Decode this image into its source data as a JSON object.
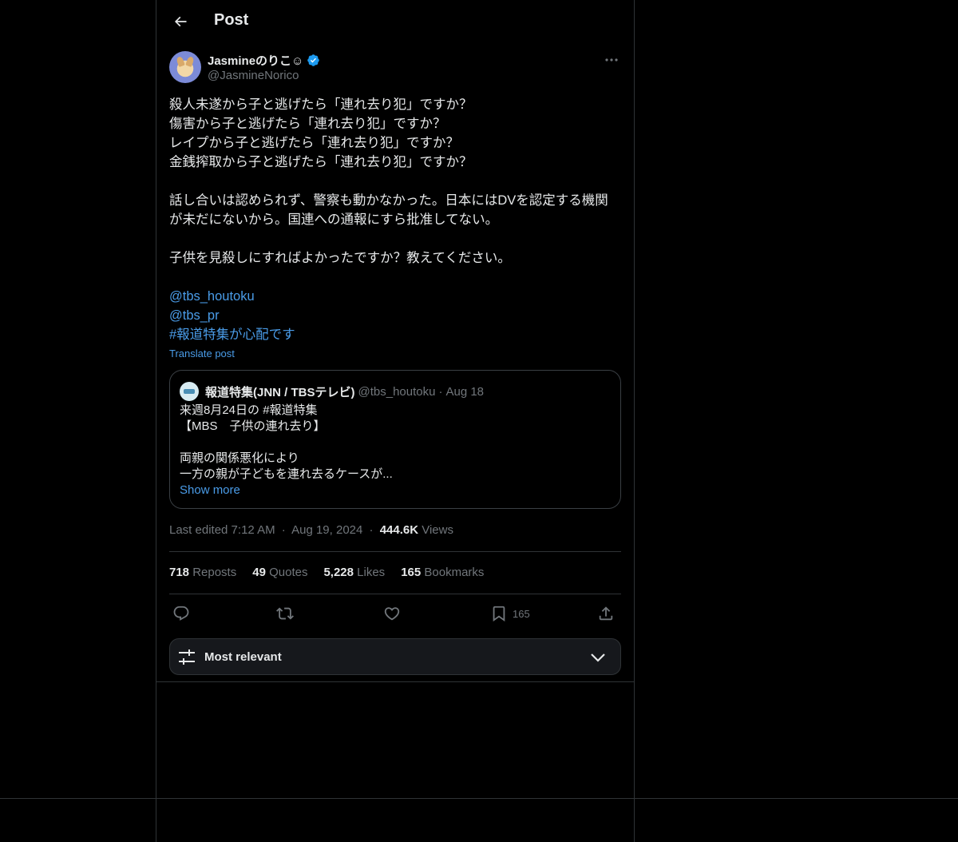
{
  "header": {
    "title": "Post"
  },
  "author": {
    "name": "Jasmineのりこ☺",
    "handle": "@JasmineNorico"
  },
  "tweet": {
    "lines": [
      "殺人未遂から子と逃げたら「連れ去り犯」ですか？",
      "傷害から子と逃げたら「連れ去り犯」ですか？",
      "レイプから子と逃げたら「連れ去り犯」ですか？",
      "金銭搾取から子と逃げたら「連れ去り犯」ですか？",
      "",
      "話し合いは認められず、警察も動かなかった。日本にはDVを認定する機関",
      "が未だにないから。国連への通報にすら批准してない。",
      "",
      "子供を見殺しにすればよかったですか？教えてください。",
      ""
    ],
    "links": [
      "@tbs_houtoku",
      "@tbs_pr",
      "#報道特集が心配です"
    ],
    "translate": "Translate post"
  },
  "quote": {
    "name": "報道特集(JNN / TBSテレビ)",
    "handle": "@tbs_houtoku",
    "separator": "·",
    "date": "Aug 18",
    "lines": [
      "来週8月24日の #報道特集",
      "【MBS　子供の連れ去り】",
      "",
      "両親の関係悪化により",
      "一方の親が子どもを連れ去るケースが..."
    ],
    "show_more": "Show more"
  },
  "meta": {
    "edited": "Last edited 7:12 AM",
    "sep1": "·",
    "date": "Aug 19, 2024",
    "sep2": "·",
    "views_count": "444.6K",
    "views_label": " Views"
  },
  "stats": {
    "reposts_count": "718",
    "reposts_label": " Reposts",
    "quotes_count": "49",
    "quotes_label": " Quotes",
    "likes_count": "5,228",
    "likes_label": " Likes",
    "bookmarks_count": "165",
    "bookmarks_label": " Bookmarks"
  },
  "actions": {
    "bookmark_count": "165"
  },
  "sort": {
    "label": "Most relevant"
  },
  "icons": [
    "back-arrow-icon",
    "verified-badge-icon",
    "more-icon",
    "reply-icon",
    "repost-icon",
    "like-icon",
    "bookmark-icon",
    "share-icon",
    "sliders-icon",
    "chevron-down-icon"
  ],
  "colors": {
    "link": "#4a9ce8",
    "verified": "#1d9bf0",
    "muted": "#71767b",
    "text": "#e7e9ea"
  }
}
